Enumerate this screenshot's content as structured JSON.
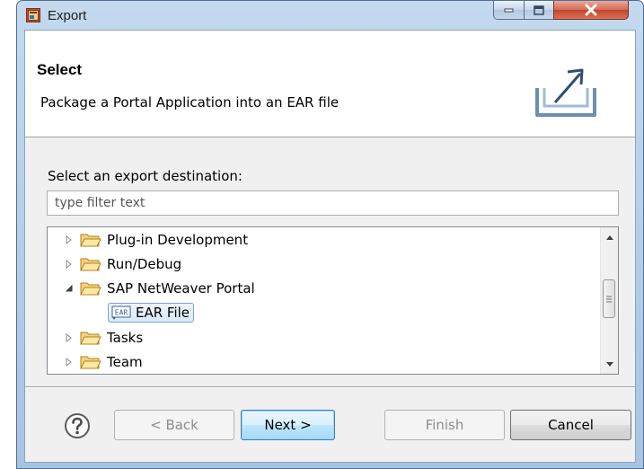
{
  "window": {
    "title": "Export"
  },
  "header": {
    "title": "Select",
    "description": "Package a Portal Application into an EAR file"
  },
  "destination": {
    "label": "Select an export destination:",
    "filter_placeholder": "type filter text",
    "filter_value": ""
  },
  "tree": {
    "items": [
      {
        "label": "Plug-in Development",
        "expanded": false
      },
      {
        "label": "Run/Debug",
        "expanded": false
      },
      {
        "label": "SAP NetWeaver Portal",
        "expanded": true
      },
      {
        "label": "EAR File",
        "selected": true,
        "icon_text": "EAR"
      },
      {
        "label": "Tasks",
        "expanded": false
      },
      {
        "label": "Team",
        "expanded": false
      }
    ]
  },
  "buttons": {
    "back": "< Back",
    "next": "Next >",
    "finish": "Finish",
    "cancel": "Cancel"
  },
  "colors": {
    "folder": "#e8b33c",
    "selection_border": "#7da2ce",
    "default_button_border": "#3c7fb1"
  }
}
